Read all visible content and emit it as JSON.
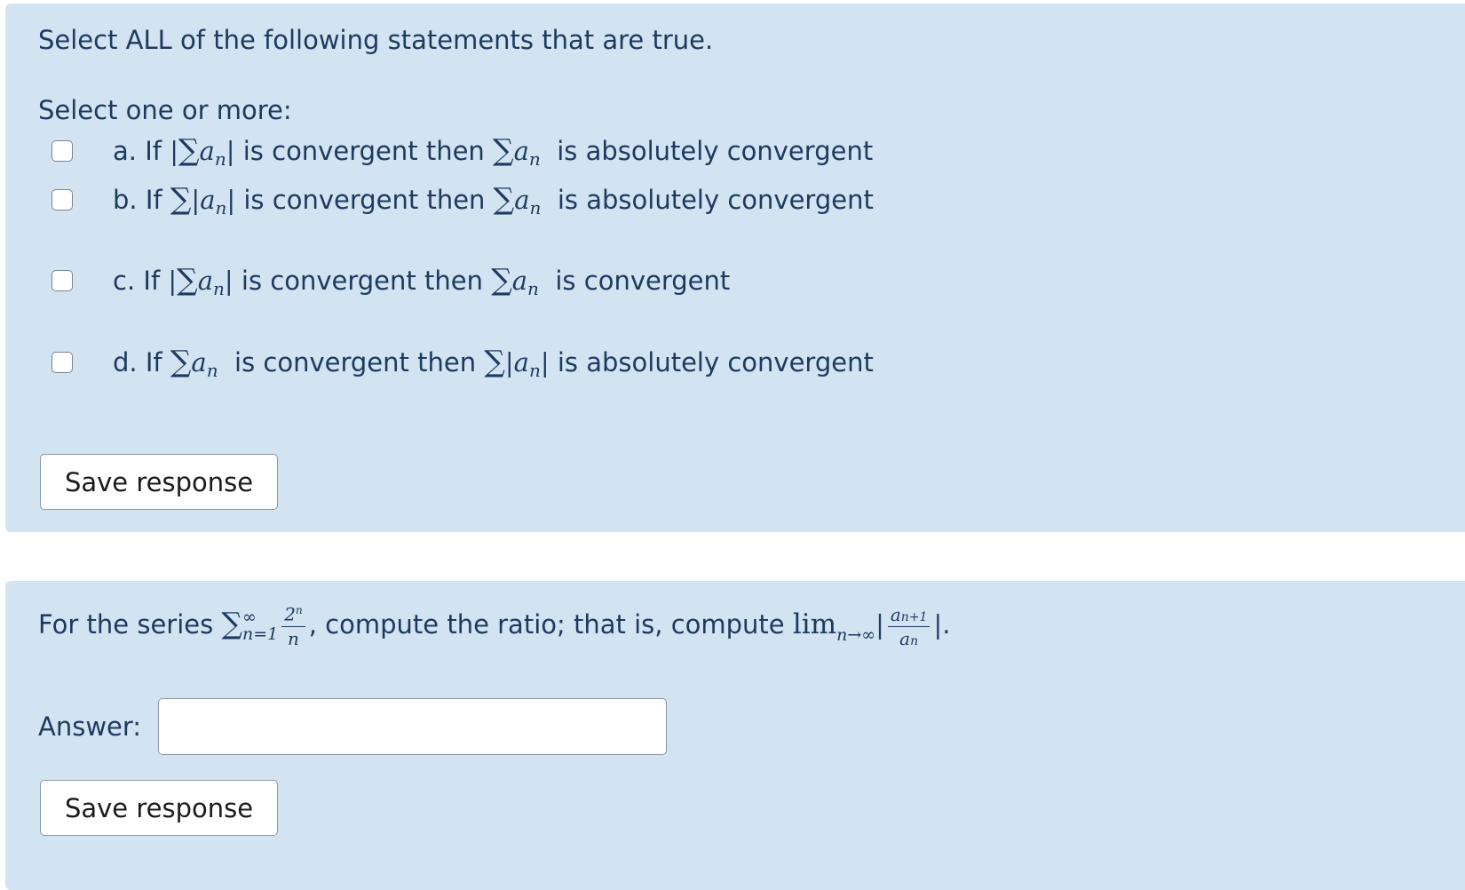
{
  "question1": {
    "prompt": "Select ALL of the following statements that are true.",
    "instruction": "Select one or more:",
    "options": [
      {
        "letter": "a.",
        "if": "If",
        "mid": "is convergent then",
        "end": "is absolutely convergent"
      },
      {
        "letter": "b.",
        "if": "If",
        "mid": "is convergent then",
        "end": "is absolutely convergent"
      },
      {
        "letter": "c.",
        "if": "If",
        "mid": "is convergent then",
        "end": "is convergent"
      },
      {
        "letter": "d.",
        "if": "If",
        "mid": "is convergent then",
        "end": "is absolutely convergent"
      }
    ],
    "save_label": "Save response"
  },
  "question2": {
    "prompt_start": "For the series",
    "prompt_mid": ", compute the ratio; that is, compute",
    "prompt_end": ".",
    "answer_label": "Answer:",
    "answer_value": "",
    "save_label": "Save response"
  }
}
